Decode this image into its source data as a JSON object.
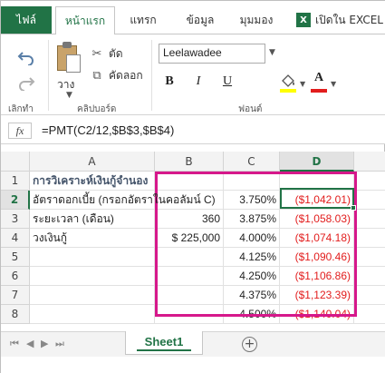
{
  "ribbon_tabs": {
    "file": "ไฟล์",
    "home": "หน้าแรก",
    "insert": "แทรก",
    "data": "ข้อมูล",
    "view": "มุมมอง",
    "open_in_excel": "เปิดใน EXCEL",
    "open_in_excel_icon": "X"
  },
  "ribbon": {
    "paste_label": "วาง",
    "cut_label": "ตัด",
    "copy_label": "คัดลอก",
    "group_undo": "เลิกทำ",
    "group_clipboard": "คลิปบอร์ด",
    "group_font": "ฟอนต์",
    "font_name": "Leelawadee",
    "bold": "B",
    "italic": "I",
    "underline": "U",
    "font_color_letter": "A"
  },
  "formula_bar": {
    "fx": "fx",
    "formula": "=PMT(C2/12,$B$3,$B$4)"
  },
  "grid": {
    "columns": [
      "A",
      "B",
      "C",
      "D"
    ],
    "rows": [
      "1",
      "2",
      "3",
      "4",
      "5",
      "6",
      "7",
      "8"
    ],
    "active_cell": "D2",
    "cells": {
      "A1": "การวิเคราะห์เงินกู้จำนอง",
      "A2": "อัตราดอกเบี้ย (กรอกอัตราในคอลัมน์ C)",
      "A3": "ระยะเวลา (เดือน)",
      "A4": "วงเงินกู้",
      "B3": "360",
      "B4": "$ 225,000",
      "C2": "3.750%",
      "C3": "3.875%",
      "C4": "4.000%",
      "C5": "4.125%",
      "C6": "4.250%",
      "C7": "4.375%",
      "C8": "4.500%",
      "D2": "($1,042.01)",
      "D3": "($1,058.03)",
      "D4": "($1,074.18)",
      "D5": "($1,090.46)",
      "D6": "($1,106.86)",
      "D7": "($1,123.39)",
      "D8": "($1,140.04)"
    }
  },
  "sheets": {
    "tabs": [
      "Sheet1"
    ],
    "add_icon": "+"
  },
  "colors": {
    "accent": "#217346",
    "negative": "#e21d1d",
    "highlight_box": "#d6188b"
  }
}
